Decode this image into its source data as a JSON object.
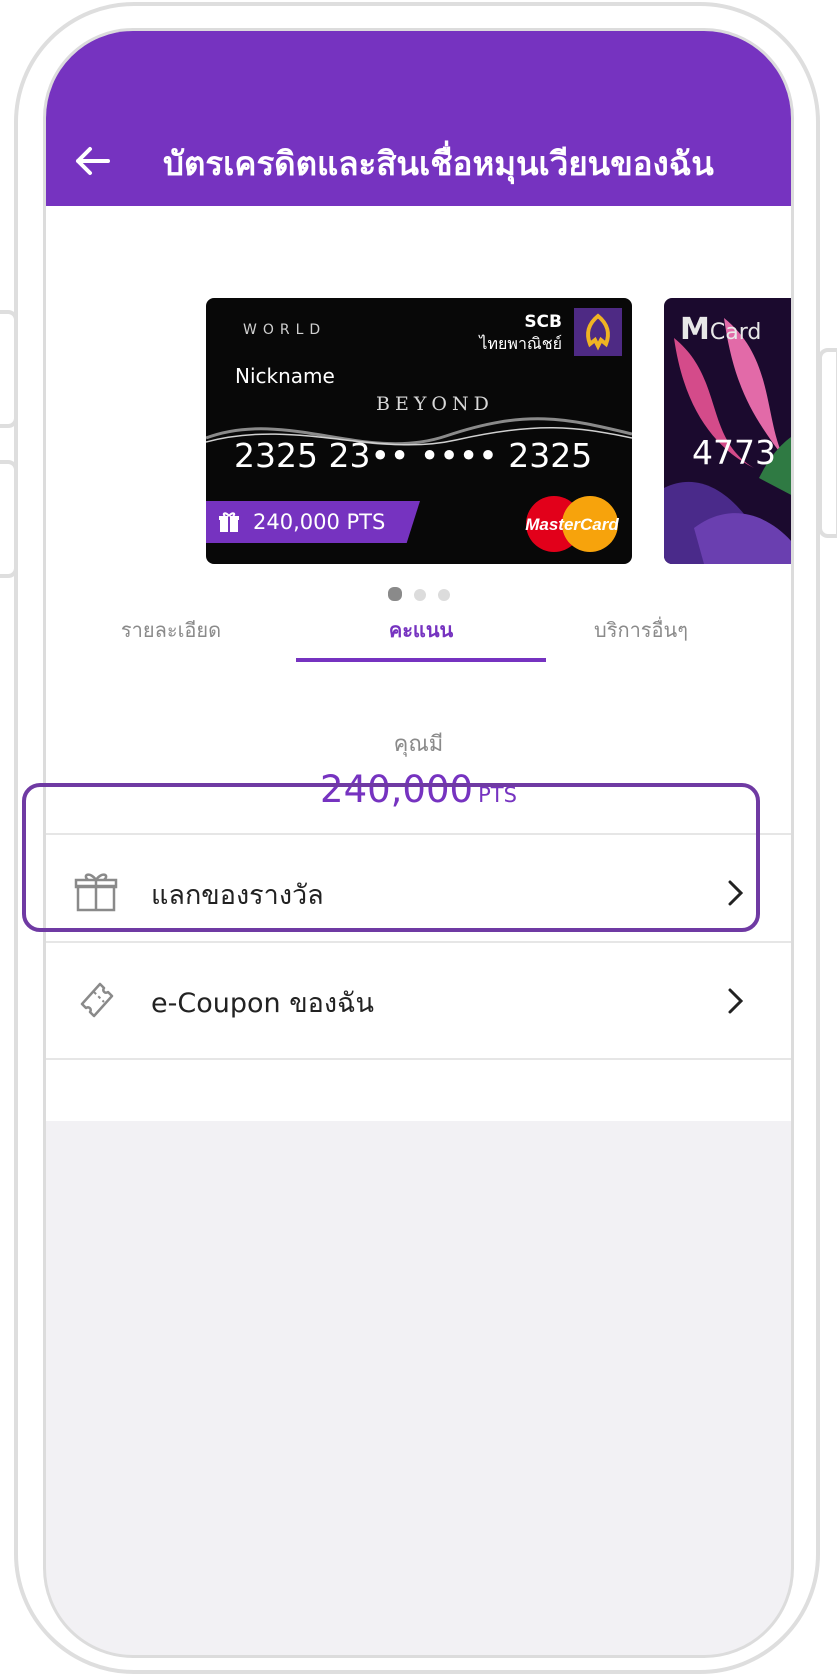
{
  "header": {
    "title": "บัตรเครดิตและสินเชื่อหมุนเวียนของฉัน",
    "back_icon": "arrow-left-icon"
  },
  "card_primary": {
    "tier": "WORLD",
    "nickname": "Nickname",
    "product": "BEYOND",
    "number": "2325 23•• •••• 2325",
    "bank_code": "SCB",
    "bank_name": "ไทยพาณิชย์",
    "points_badge": "240,000 PTS",
    "network_logo": "MasterCard"
  },
  "card_secondary": {
    "brand_m": "M",
    "brand_card": "Card",
    "number": "4773"
  },
  "carousel": {
    "page_count": 3,
    "active_index": 0
  },
  "tabs": [
    {
      "label": "รายละเอียด",
      "active": false
    },
    {
      "label": "คะแนน",
      "active": true
    },
    {
      "label": "บริการอื่นๆ",
      "active": false
    }
  ],
  "points": {
    "caption": "คุณมี",
    "value": "240,000",
    "unit": "PTS"
  },
  "menu": [
    {
      "label": "แลกของรางวัล",
      "icon": "gift-icon"
    },
    {
      "label": "e-Coupon ของฉัน",
      "icon": "coupon-icon"
    }
  ],
  "colors": {
    "brand": "#7633c0",
    "highlight": "#6f3aa3"
  }
}
